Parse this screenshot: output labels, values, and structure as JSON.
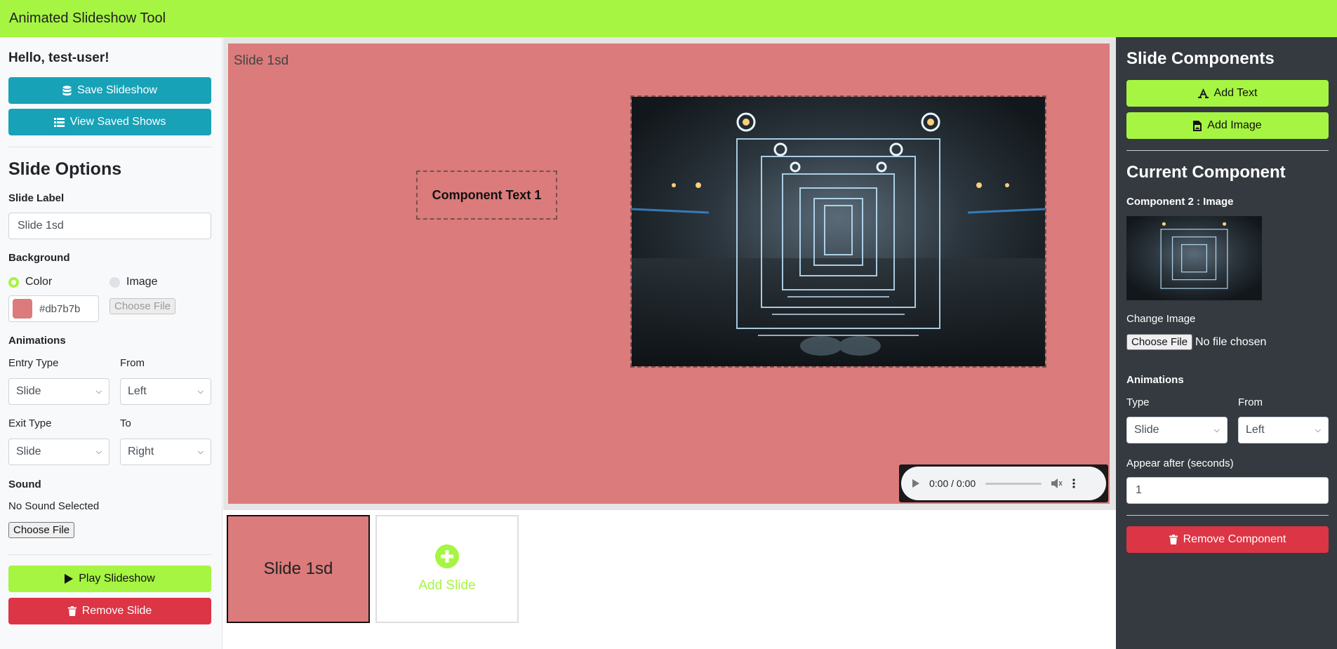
{
  "app": {
    "title": "Animated Slideshow Tool"
  },
  "left": {
    "greeting": "Hello, test-user!",
    "save_label": "Save Slideshow",
    "view_label": "View Saved Shows",
    "slide_options_heading": "Slide Options",
    "slide_label_label": "Slide Label",
    "slide_label_value": "Slide 1sd",
    "background_label": "Background",
    "bg_color_option": "Color",
    "bg_image_option": "Image",
    "bg_color_value": "#db7b7b",
    "choose_file_label": "Choose File",
    "animations_label": "Animations",
    "entry_type_label": "Entry Type",
    "entry_type_value": "Slide",
    "from_label": "From",
    "from_value": "Left",
    "exit_type_label": "Exit Type",
    "exit_type_value": "Slide",
    "to_label": "To",
    "to_value": "Right",
    "sound_label": "Sound",
    "sound_status": "No Sound Selected",
    "sound_choose_label": "Choose File",
    "play_label": "Play Slideshow",
    "remove_slide_label": "Remove Slide"
  },
  "stage": {
    "slide_label": "Slide 1sd",
    "text_component": "Component Text 1",
    "audio_time": "0:00 / 0:00"
  },
  "thumbs": {
    "slide_label": "Slide 1sd",
    "add_label": "Add Slide"
  },
  "right": {
    "components_heading": "Slide Components",
    "add_text_label": "Add Text",
    "add_image_label": "Add Image",
    "current_heading": "Current Component",
    "component_title": "Component 2 : Image",
    "change_image_label": "Change Image",
    "choose_file_label": "Choose File",
    "no_file_label": "No file chosen",
    "animations_label": "Animations",
    "type_label": "Type",
    "type_value": "Slide",
    "from_label": "From",
    "from_value": "Left",
    "appear_label": "Appear after (seconds)",
    "appear_value": "1",
    "remove_label": "Remove Component"
  },
  "colors": {
    "accent": "#a6f542",
    "slide_bg": "#db7b7b",
    "teal": "#17a2b8",
    "danger": "#dc3545",
    "dark_panel": "#343a40"
  }
}
